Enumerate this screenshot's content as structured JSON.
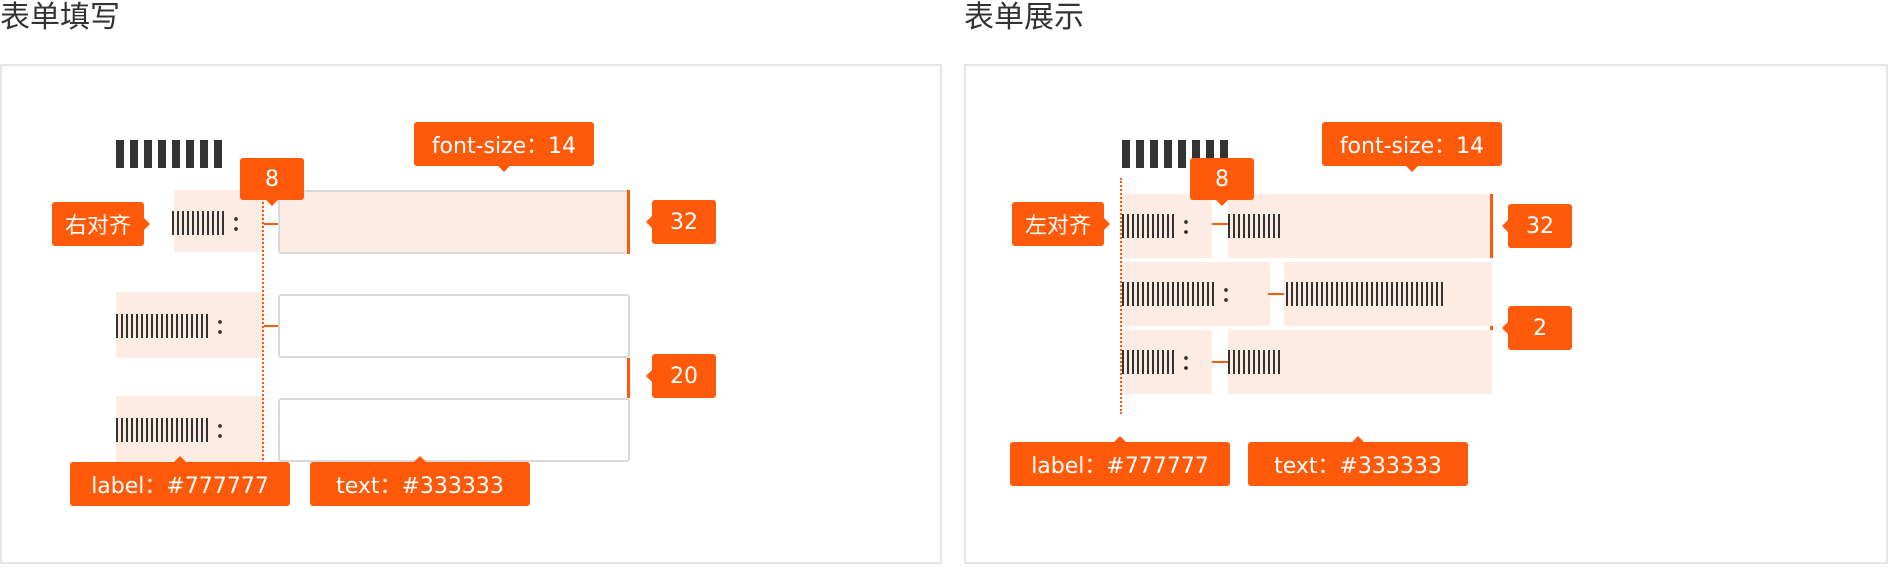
{
  "colors": {
    "accent": "#ff5a0a",
    "highlight": "#fdece4",
    "label_color": "#777777",
    "text_color": "#333333"
  },
  "left": {
    "title": "表单填写",
    "align_tag": "右对齐",
    "font_size_tag": "font-size：14",
    "gap_tag": "8",
    "height_tag": "32",
    "spacing_tag": "20",
    "label_tag": "label：#777777",
    "text_tag": "text：#333333",
    "label_suffix": "："
  },
  "right": {
    "title": "表单展示",
    "align_tag": "左对齐",
    "font_size_tag": "font-size：14",
    "gap_tag": "8",
    "height_tag": "32",
    "spacing_tag": "2",
    "label_tag": "label：#777777",
    "text_tag": "text：#333333",
    "label_suffix": "："
  }
}
